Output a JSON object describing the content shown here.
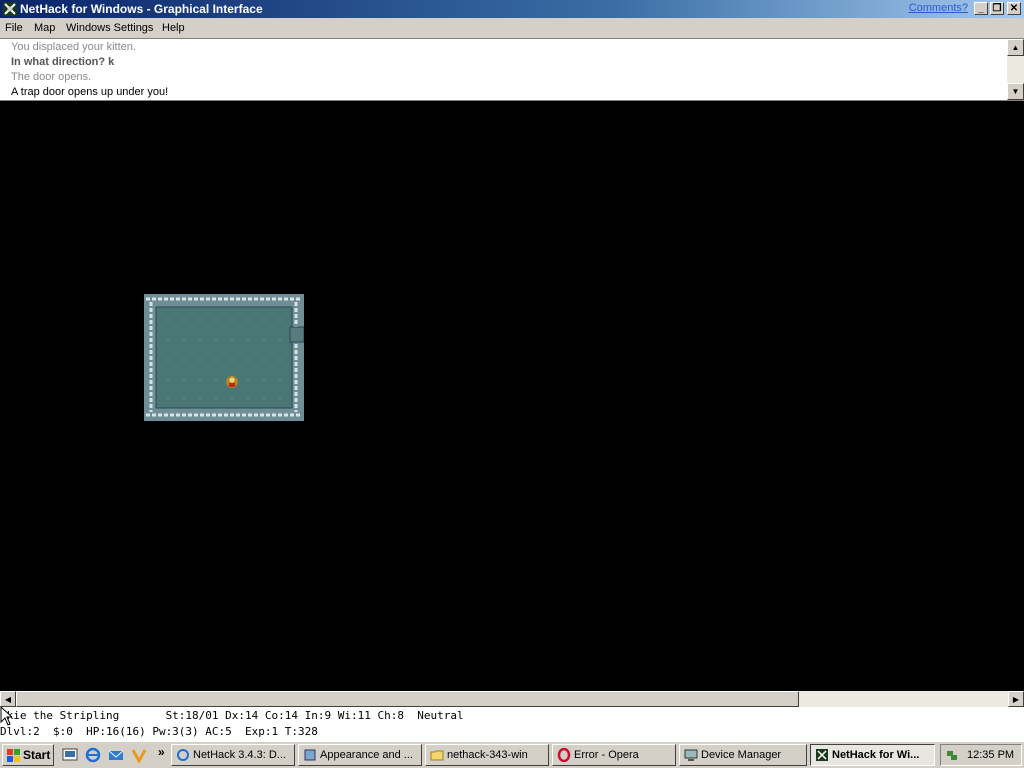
{
  "window": {
    "title": "NetHack for Windows - Graphical Interface",
    "comments_link": "Comments?",
    "min_glyph": "_",
    "max_glyph": "❐",
    "close_glyph": "✕"
  },
  "menu": [
    "File",
    "Map",
    "Windows Settings",
    "Help"
  ],
  "messages": [
    {
      "text": "You displaced your kitten.",
      "style": "dim"
    },
    {
      "text": "In what direction? k",
      "style": "bold"
    },
    {
      "text": "The door opens.",
      "style": "dim"
    },
    {
      "text": "A trap door opens up under you!",
      "style": "current"
    }
  ],
  "scroll_glyphs": {
    "up": "▲",
    "down": "▼",
    "left": "◀",
    "right": "▶"
  },
  "status": {
    "line1": "rkie the Stripling       St:18/01 Dx:14 Co:14 In:9 Wi:11 Ch:8  Neutral",
    "line2": "Dlvl:2  $:0  HP:16(16) Pw:3(3) AC:5  Exp:1 T:328"
  },
  "taskbar": {
    "start_label": "Start",
    "quicklaunch_more": "»",
    "tasks": [
      {
        "label": "NetHack 3.4.3: D...",
        "icon": "ie-icon",
        "active": false
      },
      {
        "label": "Appearance and ...",
        "icon": "control-panel-icon",
        "active": false
      },
      {
        "label": "nethack-343-win",
        "icon": "folder-icon",
        "active": false
      },
      {
        "label": "Error - Opera",
        "icon": "opera-icon",
        "active": false
      },
      {
        "label": "Device Manager",
        "icon": "device-manager-icon",
        "active": false
      },
      {
        "label": "NetHack for Wi...",
        "icon": "nethack-icon",
        "active": true
      }
    ],
    "clock": "12:35 PM"
  },
  "colors": {
    "room_floor": "#4a7676",
    "room_wall": "#6f8e98",
    "titlebar_start": "#0a246a",
    "titlebar_end": "#a6caf0"
  }
}
